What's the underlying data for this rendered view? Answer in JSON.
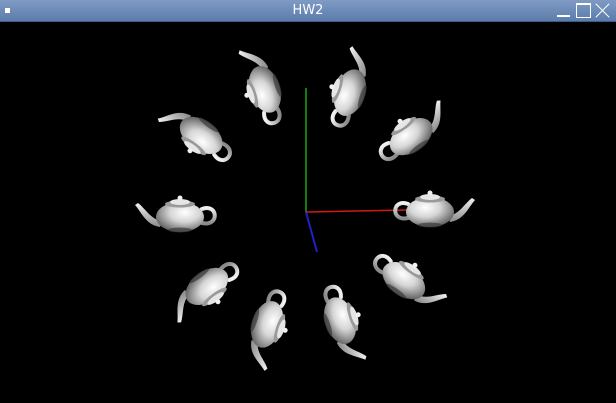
{
  "window": {
    "title": "HW2",
    "icons": {
      "menu": "window-menu-icon",
      "minimize": "minimize-icon",
      "maximize": "maximize-icon",
      "close": "close-icon"
    }
  },
  "scene": {
    "background": "#000000",
    "teapot_color": "#d8d8d8",
    "teapot_count": 10,
    "axis_colors": {
      "x": "#d01818",
      "y": "#18a818",
      "z": "#2020c8"
    }
  }
}
